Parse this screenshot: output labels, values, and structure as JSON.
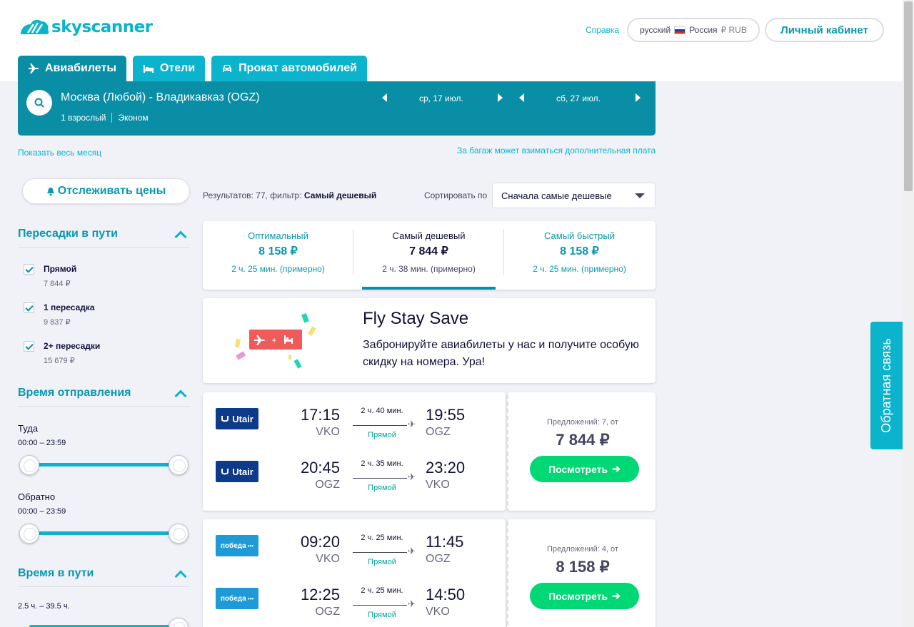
{
  "header": {
    "logo_text": "skyscanner",
    "help": "Справка",
    "locale": {
      "language": "русский",
      "country": "Россия",
      "currency": "₽ RUB"
    },
    "account": "Личный кабинет"
  },
  "tabs": [
    {
      "label": "Авиабилеты",
      "icon": "plane-icon",
      "active": true
    },
    {
      "label": "Отели",
      "icon": "bed-icon",
      "active": false
    },
    {
      "label": "Прокат автомобилей",
      "icon": "car-icon",
      "active": false
    }
  ],
  "search": {
    "route": "Москва (Любой) - Владикавказ (OGZ)",
    "passengers": "1 взрослый",
    "cabin": "Эконом",
    "depart_date": "ср, 17 июл.",
    "return_date": "сб, 27 июл."
  },
  "links": {
    "show_month": "Показать весь месяц",
    "baggage": "За багаж может взиматься дополнительная плата"
  },
  "sidebar": {
    "track_prices": "Отслеживать цены",
    "stops": {
      "title": "Пересадки в пути",
      "options": [
        {
          "label": "Прямой",
          "price": "7 844 ₽",
          "checked": true
        },
        {
          "label": "1 пересадка",
          "price": "9 837 ₽",
          "checked": true
        },
        {
          "label": "2+ пересадки",
          "price": "15 679 ₽",
          "checked": true
        }
      ]
    },
    "departure_time": {
      "title": "Время отправления",
      "outbound_label": "Туда",
      "outbound_range": "00:00 – 23:59",
      "return_label": "Обратно",
      "return_range": "00:00 – 23:59"
    },
    "duration": {
      "title": "Время в пути",
      "range": "2.5 ч. – 39.5 ч."
    }
  },
  "results": {
    "count_text": "Результатов: 77, фильтр:",
    "filter": "Самый дешевый",
    "sort_label": "Сортировать по",
    "sort_value": "Сначала самые дешевые"
  },
  "summary": [
    {
      "label": "Оптимальный",
      "price": "8 158 ₽",
      "duration": "2 ч. 25 мин. (примерно)",
      "selected": false
    },
    {
      "label": "Самый дешевый",
      "price": "7 844 ₽",
      "duration": "2 ч. 38 мин. (примерно)",
      "selected": true
    },
    {
      "label": "Самый быстрый",
      "price": "8 158 ₽",
      "duration": "2 ч. 25 мин. (примерно)",
      "selected": false
    }
  ],
  "promo": {
    "title": "Fly Stay Save",
    "text": "Забронируйте авиабилеты у нас и получите особую скидку на номера. Ура!",
    "badge_plus": "+"
  },
  "tickets": [
    {
      "offers": "Предложений: 7, от",
      "price": "7 844 ₽",
      "button": "Посмотреть",
      "legs": [
        {
          "airline": "Utair",
          "dep_time": "17:15",
          "dep_code": "VKO",
          "duration": "2 ч. 40 мин.",
          "stops": "Прямой",
          "arr_time": "19:55",
          "arr_code": "OGZ"
        },
        {
          "airline": "Utair",
          "dep_time": "20:45",
          "dep_code": "OGZ",
          "duration": "2 ч. 35 мин.",
          "stops": "Прямой",
          "arr_time": "23:20",
          "arr_code": "VKO"
        }
      ]
    },
    {
      "offers": "Предложений: 4, от",
      "price": "8 158 ₽",
      "button": "Посмотреть",
      "legs": [
        {
          "airline": "победа",
          "dep_time": "09:20",
          "dep_code": "VKO",
          "duration": "2 ч. 25 мин.",
          "stops": "Прямой",
          "arr_time": "11:45",
          "arr_code": "OGZ"
        },
        {
          "airline": "победа",
          "dep_time": "12:25",
          "dep_code": "OGZ",
          "duration": "2 ч. 25 мин.",
          "stops": "Прямой",
          "arr_time": "14:50",
          "arr_code": "VKO"
        }
      ]
    }
  ],
  "feedback": "Обратная связь",
  "colors": {
    "brand": "#0bb3cc",
    "brand_dark": "#0a8ea6",
    "cta": "#00d775",
    "direct": "#00a698"
  }
}
